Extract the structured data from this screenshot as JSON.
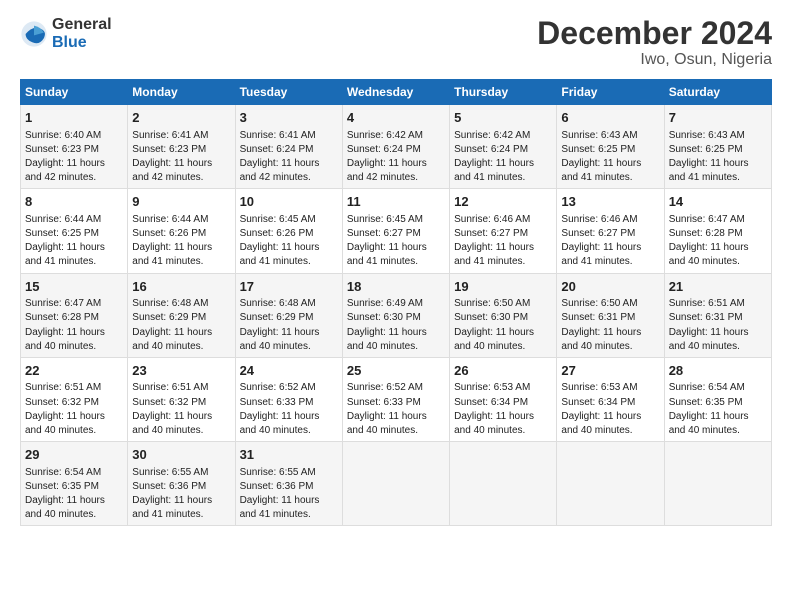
{
  "logo": {
    "general": "General",
    "blue": "Blue"
  },
  "title": "December 2024",
  "subtitle": "Iwo, Osun, Nigeria",
  "days_header": [
    "Sunday",
    "Monday",
    "Tuesday",
    "Wednesday",
    "Thursday",
    "Friday",
    "Saturday"
  ],
  "weeks": [
    [
      {
        "day": "1",
        "rise": "6:40 AM",
        "set": "6:23 PM",
        "daylight": "11 hours and 42 minutes."
      },
      {
        "day": "2",
        "rise": "6:41 AM",
        "set": "6:23 PM",
        "daylight": "11 hours and 42 minutes."
      },
      {
        "day": "3",
        "rise": "6:41 AM",
        "set": "6:24 PM",
        "daylight": "11 hours and 42 minutes."
      },
      {
        "day": "4",
        "rise": "6:42 AM",
        "set": "6:24 PM",
        "daylight": "11 hours and 42 minutes."
      },
      {
        "day": "5",
        "rise": "6:42 AM",
        "set": "6:24 PM",
        "daylight": "11 hours and 41 minutes."
      },
      {
        "day": "6",
        "rise": "6:43 AM",
        "set": "6:25 PM",
        "daylight": "11 hours and 41 minutes."
      },
      {
        "day": "7",
        "rise": "6:43 AM",
        "set": "6:25 PM",
        "daylight": "11 hours and 41 minutes."
      }
    ],
    [
      {
        "day": "8",
        "rise": "6:44 AM",
        "set": "6:25 PM",
        "daylight": "11 hours and 41 minutes."
      },
      {
        "day": "9",
        "rise": "6:44 AM",
        "set": "6:26 PM",
        "daylight": "11 hours and 41 minutes."
      },
      {
        "day": "10",
        "rise": "6:45 AM",
        "set": "6:26 PM",
        "daylight": "11 hours and 41 minutes."
      },
      {
        "day": "11",
        "rise": "6:45 AM",
        "set": "6:27 PM",
        "daylight": "11 hours and 41 minutes."
      },
      {
        "day": "12",
        "rise": "6:46 AM",
        "set": "6:27 PM",
        "daylight": "11 hours and 41 minutes."
      },
      {
        "day": "13",
        "rise": "6:46 AM",
        "set": "6:27 PM",
        "daylight": "11 hours and 41 minutes."
      },
      {
        "day": "14",
        "rise": "6:47 AM",
        "set": "6:28 PM",
        "daylight": "11 hours and 40 minutes."
      }
    ],
    [
      {
        "day": "15",
        "rise": "6:47 AM",
        "set": "6:28 PM",
        "daylight": "11 hours and 40 minutes."
      },
      {
        "day": "16",
        "rise": "6:48 AM",
        "set": "6:29 PM",
        "daylight": "11 hours and 40 minutes."
      },
      {
        "day": "17",
        "rise": "6:48 AM",
        "set": "6:29 PM",
        "daylight": "11 hours and 40 minutes."
      },
      {
        "day": "18",
        "rise": "6:49 AM",
        "set": "6:30 PM",
        "daylight": "11 hours and 40 minutes."
      },
      {
        "day": "19",
        "rise": "6:50 AM",
        "set": "6:30 PM",
        "daylight": "11 hours and 40 minutes."
      },
      {
        "day": "20",
        "rise": "6:50 AM",
        "set": "6:31 PM",
        "daylight": "11 hours and 40 minutes."
      },
      {
        "day": "21",
        "rise": "6:51 AM",
        "set": "6:31 PM",
        "daylight": "11 hours and 40 minutes."
      }
    ],
    [
      {
        "day": "22",
        "rise": "6:51 AM",
        "set": "6:32 PM",
        "daylight": "11 hours and 40 minutes."
      },
      {
        "day": "23",
        "rise": "6:51 AM",
        "set": "6:32 PM",
        "daylight": "11 hours and 40 minutes."
      },
      {
        "day": "24",
        "rise": "6:52 AM",
        "set": "6:33 PM",
        "daylight": "11 hours and 40 minutes."
      },
      {
        "day": "25",
        "rise": "6:52 AM",
        "set": "6:33 PM",
        "daylight": "11 hours and 40 minutes."
      },
      {
        "day": "26",
        "rise": "6:53 AM",
        "set": "6:34 PM",
        "daylight": "11 hours and 40 minutes."
      },
      {
        "day": "27",
        "rise": "6:53 AM",
        "set": "6:34 PM",
        "daylight": "11 hours and 40 minutes."
      },
      {
        "day": "28",
        "rise": "6:54 AM",
        "set": "6:35 PM",
        "daylight": "11 hours and 40 minutes."
      }
    ],
    [
      {
        "day": "29",
        "rise": "6:54 AM",
        "set": "6:35 PM",
        "daylight": "11 hours and 40 minutes."
      },
      {
        "day": "30",
        "rise": "6:55 AM",
        "set": "6:36 PM",
        "daylight": "11 hours and 41 minutes."
      },
      {
        "day": "31",
        "rise": "6:55 AM",
        "set": "6:36 PM",
        "daylight": "11 hours and 41 minutes."
      },
      null,
      null,
      null,
      null
    ]
  ],
  "labels": {
    "sunrise": "Sunrise:",
    "sunset": "Sunset:",
    "daylight": "Daylight:"
  }
}
